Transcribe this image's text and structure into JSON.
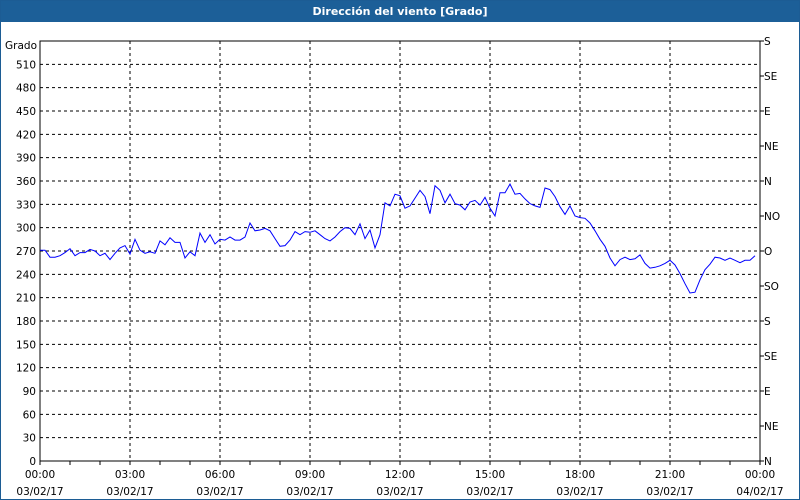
{
  "title": "Dirección del viento [Grado]",
  "chart_data": {
    "type": "line",
    "title": "Dirección del viento [Grado]",
    "ylabel": "Grado",
    "ylim": [
      0,
      540
    ],
    "yticks": [
      0,
      30,
      60,
      90,
      120,
      150,
      180,
      210,
      240,
      270,
      300,
      330,
      360,
      390,
      420,
      450,
      480,
      510
    ],
    "right_axis": {
      "ticks": [
        {
          "value": 0,
          "label": "N"
        },
        {
          "value": 45,
          "label": "NE"
        },
        {
          "value": 90,
          "label": "E"
        },
        {
          "value": 135,
          "label": "SE"
        },
        {
          "value": 180,
          "label": "S"
        },
        {
          "value": 225,
          "label": "SO"
        },
        {
          "value": 270,
          "label": "O"
        },
        {
          "value": 315,
          "label": "NO"
        },
        {
          "value": 360,
          "label": "N"
        },
        {
          "value": 405,
          "label": "NE"
        },
        {
          "value": 450,
          "label": "E"
        },
        {
          "value": 495,
          "label": "SE"
        },
        {
          "value": 540,
          "label": "S"
        }
      ]
    },
    "xlim_hours": [
      0,
      24
    ],
    "xticks": [
      {
        "hour": 0,
        "time": "00:00",
        "date": "03/02/17"
      },
      {
        "hour": 3,
        "time": "03:00",
        "date": "03/02/17"
      },
      {
        "hour": 6,
        "time": "06:00",
        "date": "03/02/17"
      },
      {
        "hour": 9,
        "time": "09:00",
        "date": "03/02/17"
      },
      {
        "hour": 12,
        "time": "12:00",
        "date": "03/02/17"
      },
      {
        "hour": 15,
        "time": "15:00",
        "date": "03/02/17"
      },
      {
        "hour": 18,
        "time": "18:00",
        "date": "03/02/17"
      },
      {
        "hour": 21,
        "time": "21:00",
        "date": "03/02/17"
      },
      {
        "hour": 24,
        "time": "00:00",
        "date": "04/02/17"
      }
    ],
    "grid": true,
    "series": [
      {
        "name": "Dirección del viento",
        "color": "#0000ff",
        "interval_minutes": 10,
        "values": [
          271,
          271,
          262,
          262,
          264,
          268,
          273,
          264,
          268,
          268,
          272,
          270,
          264,
          267,
          259,
          267,
          274,
          277,
          266,
          285,
          271,
          267,
          269,
          267,
          283,
          278,
          287,
          281,
          281,
          261,
          269,
          264,
          293,
          281,
          291,
          279,
          285,
          284,
          288,
          284,
          284,
          288,
          306,
          296,
          297,
          299,
          296,
          286,
          276,
          277,
          284,
          295,
          291,
          295,
          294,
          296,
          291,
          286,
          283,
          288,
          295,
          300,
          299,
          291,
          305,
          286,
          297,
          274,
          291,
          332,
          328,
          343,
          341,
          325,
          328,
          338,
          348,
          340,
          318,
          354,
          348,
          332,
          343,
          331,
          329,
          323,
          333,
          335,
          329,
          339,
          325,
          315,
          345,
          345,
          356,
          343,
          344,
          337,
          331,
          328,
          326,
          351,
          349,
          340,
          327,
          317,
          328,
          315,
          313,
          312,
          306,
          296,
          285,
          276,
          261,
          251,
          259,
          262,
          259,
          260,
          265,
          254,
          248,
          249,
          251,
          254,
          258,
          252,
          241,
          228,
          216,
          217,
          233,
          246,
          253,
          262,
          261,
          258,
          261,
          258,
          255,
          258,
          258,
          264
        ]
      }
    ]
  }
}
